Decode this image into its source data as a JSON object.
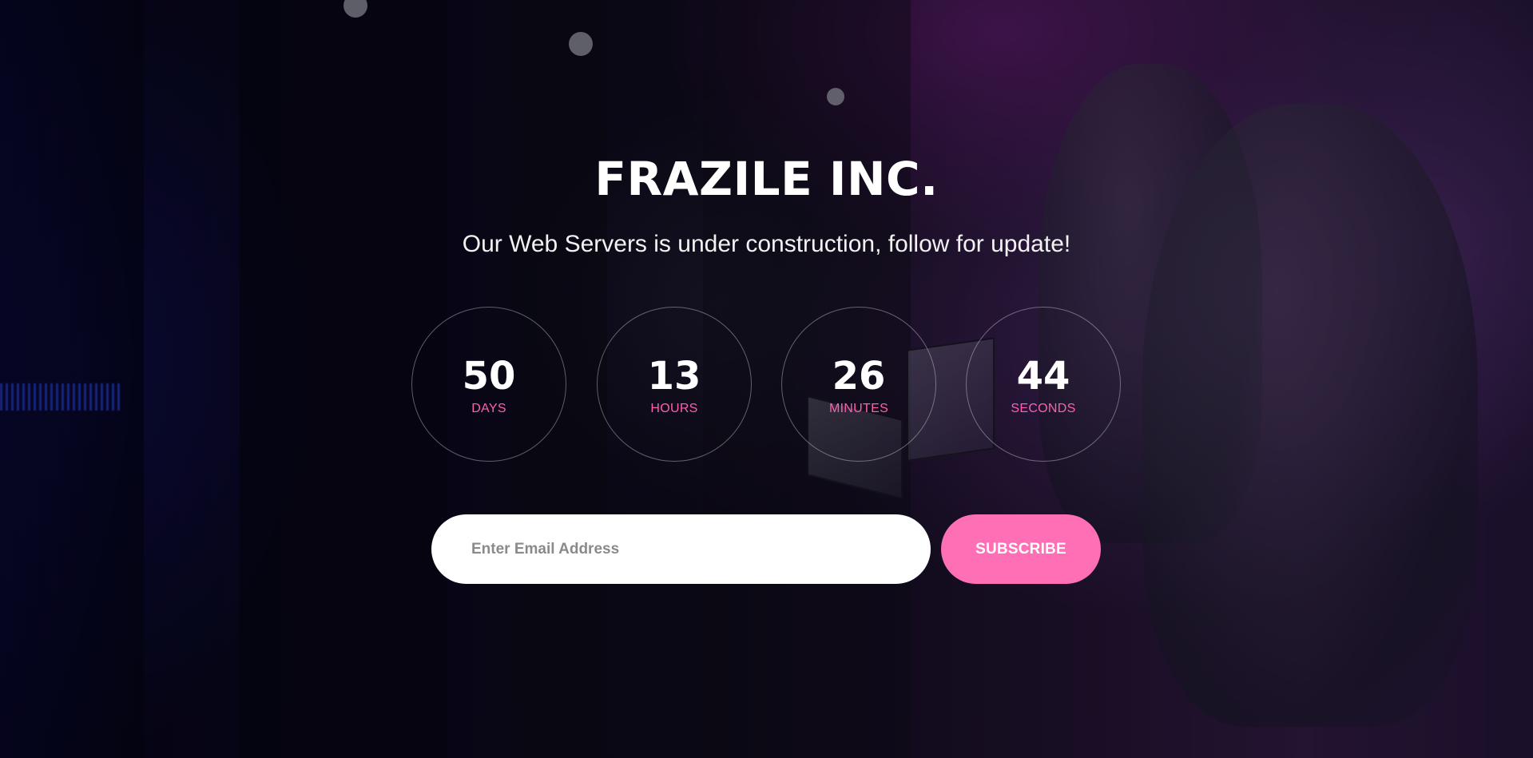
{
  "header": {
    "title": "FRAZILE INC.",
    "subtitle": "Our Web Servers is under construction, follow for update!"
  },
  "countdown": [
    {
      "value": "50",
      "label": "DAYS"
    },
    {
      "value": "13",
      "label": "HOURS"
    },
    {
      "value": "26",
      "label": "MINUTES"
    },
    {
      "value": "44",
      "label": "SECONDS"
    }
  ],
  "subscribe": {
    "placeholder": "Enter Email Address",
    "button_label": "SUBSCRIBE"
  },
  "colors": {
    "accent": "#ff6fb6",
    "label_accent": "#ff5fb0",
    "text": "#ffffff"
  }
}
